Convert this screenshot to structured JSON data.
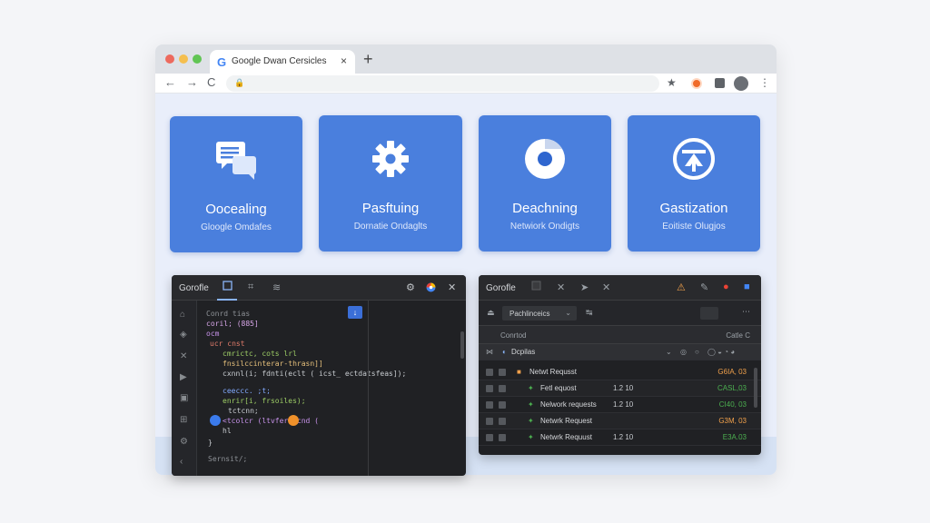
{
  "browser": {
    "tab_title": "Google Dwan Cersicles",
    "tab_g": "G",
    "tab_close": "×",
    "new_tab": "+",
    "nav_back": "←",
    "nav_forward": "→",
    "nav_reload": "C",
    "lock": "🔒",
    "star": "★",
    "menu": "⋮"
  },
  "cards": [
    {
      "title": "Oocealing",
      "subtitle": "Gloogle Omdafes",
      "icon": "chat-bubbles-icon"
    },
    {
      "title": "Pasftuing",
      "subtitle": "Dornatie Ondaglts",
      "icon": "gear-icon"
    },
    {
      "title": "Deachning",
      "subtitle": "Netwiork Ondigts",
      "icon": "chrome-icon"
    },
    {
      "title": "Gastization",
      "subtitle": "Eoitiste Olugjos",
      "icon": "tool-upload-icon"
    }
  ],
  "devtools_left": {
    "title": "Gorofle",
    "run_btn": "↓",
    "code": [
      {
        "text": "Conrd tias",
        "color": "#8d9196"
      },
      {
        "text": "coril; (885]",
        "color": "#d7a6e8"
      },
      {
        "text": "ocm",
        "color": "#c792ea"
      },
      {
        "text": "ucr cnst",
        "color": "#e07b6a"
      },
      {
        "text": "cmrictc, cots lrl",
        "color": "#9ccc65"
      },
      {
        "text": "fnsilccinterar-thrasn]]",
        "color": "#e6c07b"
      },
      {
        "text": "cxnnl(i; fdnti(eclt ( icst_ ectdatsfeas]);",
        "color": "#c8ccd0"
      },
      {
        "text": "ceeccc. ;t;",
        "color": "#82aaff"
      },
      {
        "text": "enrir[i, frsoiles);",
        "color": "#9ccc65"
      },
      {
        "text": "tctcnn;",
        "color": "#c8ccd0"
      },
      {
        "text": "<tcolcr (ltvfer tcnd (",
        "color": "#c792ea"
      },
      {
        "text": "hl",
        "color": "#c8ccd0"
      },
      {
        "text": "}",
        "color": "#c8ccd0"
      },
      {
        "text": "Sernsit/;",
        "color": "#8d9196"
      }
    ]
  },
  "devtools_right": {
    "title": "Gorofle",
    "filter_value": "Pachlinceics",
    "col_left": "Conrtod",
    "col_right": "Catle C",
    "group_label": "Dcpilas",
    "rows": [
      {
        "name": "Netwt Requsst",
        "size": "",
        "value": "G6IA, 03",
        "value_color": "#f0a04b",
        "dot_color": "#f0a04b"
      },
      {
        "name": "Fetl equost",
        "size": "1.2 10",
        "value": "CASL,03",
        "value_color": "#4caf50",
        "dot_color": "#4caf50"
      },
      {
        "name": "Nelwork requests",
        "size": "1.2 10",
        "value": "CI40, 03",
        "value_color": "#4caf50",
        "dot_color": "#4caf50"
      },
      {
        "name": "Netwrk Request",
        "size": "",
        "value": "G3M, 03",
        "value_color": "#f0a04b",
        "dot_color": "#4caf50"
      },
      {
        "name": "Netwrk Requust",
        "size": "1.2 10",
        "value": "E3A.03",
        "value_color": "#4caf50",
        "dot_color": "#4caf50"
      }
    ]
  }
}
